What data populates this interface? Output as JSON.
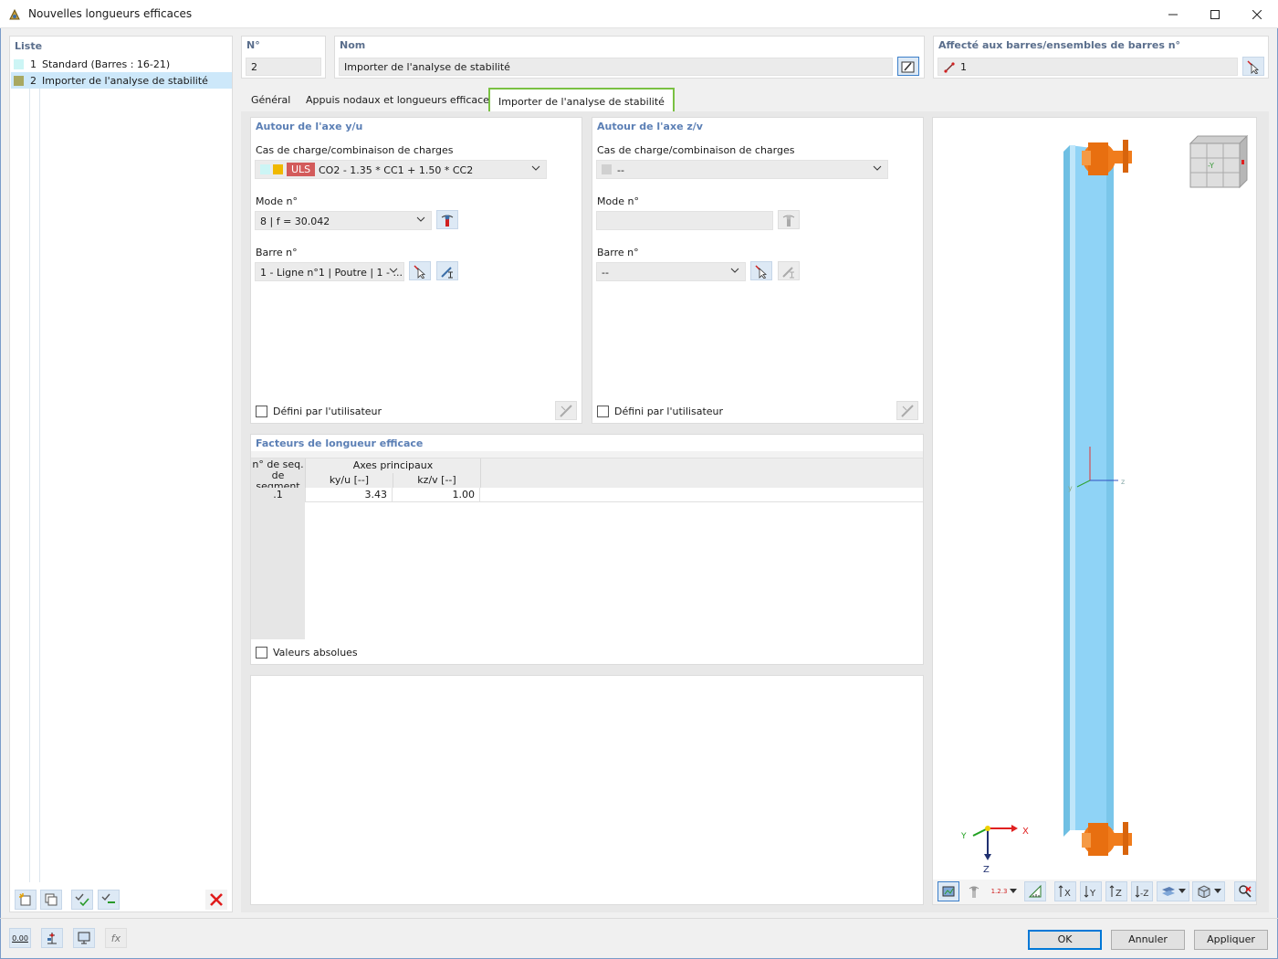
{
  "window": {
    "title": "Nouvelles longueurs efficaces"
  },
  "list": {
    "header": "Liste",
    "items": [
      {
        "num": "1",
        "label": "Standard (Barres : 16-21)",
        "color": "#ccf5f5",
        "selected": false
      },
      {
        "num": "2",
        "label": "Importer de l'analyse de stabilité",
        "color": "#a8a862",
        "selected": true
      }
    ]
  },
  "no_field": {
    "label": "N°",
    "value": "2"
  },
  "name_field": {
    "label": "Nom",
    "value": "Importer de l'analyse de stabilité"
  },
  "assigned": {
    "label": "Affecté aux barres/ensembles de barres n°",
    "value": "1"
  },
  "tabs": [
    {
      "label": "Général"
    },
    {
      "label": "Appuis nodaux et longueurs efficaces"
    },
    {
      "label": "Importer de l'analyse de stabilité",
      "active": true
    }
  ],
  "axis_y": {
    "title": "Autour de l'axe y/u",
    "load_label": "Cas de charge/combinaison de charges",
    "load_tag": "ULS",
    "load_value": "CO2 - 1.35 * CC1 + 1.50 * CC2",
    "mode_label": "Mode n°",
    "mode_value": "8 | f = 30.042",
    "member_label": "Barre n°",
    "member_value": "1 - Ligne n°1 | Poutre | 1 - ...",
    "user_defined": "Défini par l'utilisateur"
  },
  "axis_z": {
    "title": "Autour de l'axe z/v",
    "load_label": "Cas de charge/combinaison de charges",
    "load_value": "--",
    "mode_label": "Mode n°",
    "mode_value": "",
    "member_label": "Barre n°",
    "member_value": "--",
    "user_defined": "Défini par l'utilisateur"
  },
  "factors": {
    "title": "Facteurs de longueur efficace",
    "col_seq": "n° de seq. de segment",
    "col_group": "Axes principaux",
    "col_ky": "ky/u [--]",
    "col_kz": "kz/v [--]",
    "rows": [
      {
        "seq": ".1",
        "ky": "3.43",
        "kz": "1.00"
      }
    ],
    "absolute": "Valeurs absolues"
  },
  "view3d": {
    "axis_labels": {
      "x": "X",
      "y": "Y",
      "z": "Z"
    },
    "member_axis_labels": {
      "y": "y",
      "z": "z"
    },
    "cube_face": "-Y",
    "colors": {
      "member": "#8fd3f6",
      "support": "#f07c1c"
    }
  },
  "buttons": {
    "ok": "OK",
    "cancel": "Annuler",
    "apply": "Appliquer"
  },
  "bottom_tools": {
    "value_icon": "0.00",
    "fx": "fx"
  },
  "view_toolbar_numbers": "1.2.3"
}
